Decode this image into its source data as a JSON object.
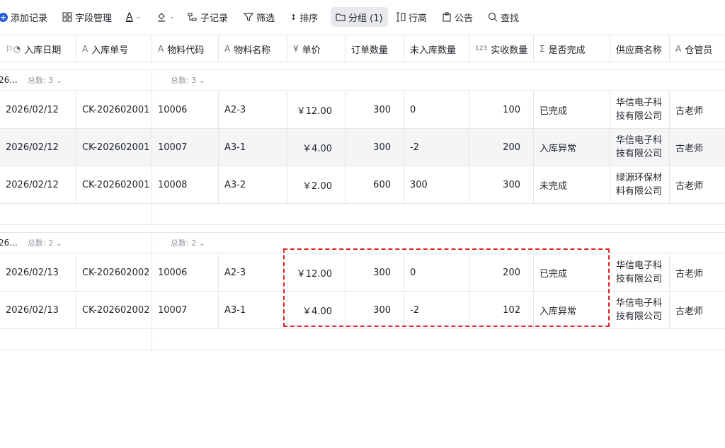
{
  "toolbar": {
    "add_record": "添加记录",
    "field_manage": "字段管理",
    "sub_record": "子记录",
    "filter": "筛选",
    "sort": "排序",
    "group": "分组 (1)",
    "row_height": "行高",
    "announcement": "公告",
    "search": "查找"
  },
  "columns": [
    {
      "label": "入库日期",
      "icon": "flag-clock-icon"
    },
    {
      "label": "入库单号",
      "icon": "text-A-icon"
    },
    {
      "label": "物料代码",
      "icon": "text-A-icon"
    },
    {
      "label": "物料名称",
      "icon": "text-A-icon"
    },
    {
      "label": "单价",
      "icon": "yen-icon"
    },
    {
      "label": "订单数量",
      "icon": ""
    },
    {
      "label": "未入库数量",
      "icon": ""
    },
    {
      "label": "实收数量",
      "icon": "number-123-icon"
    },
    {
      "label": "是否完成",
      "icon": "sigma-icon"
    },
    {
      "label": "供应商名称",
      "icon": ""
    },
    {
      "label": "仓管员",
      "icon": "text-A-icon"
    }
  ],
  "groups": [
    {
      "name": "26...",
      "count_left": "总数: 3",
      "count_right": "总数: 3",
      "rows": [
        {
          "date": "2026/02/12",
          "order_no": "CK-202602001",
          "code": "10006",
          "name": "A2-3",
          "price": "￥12.00",
          "qty": "300",
          "pending": "0",
          "received": "100",
          "status": "已完成",
          "supplier": "华信电子科技有限公司",
          "keeper": "古老师"
        },
        {
          "date": "2026/02/12",
          "order_no": "CK-202602001",
          "code": "10007",
          "name": "A3-1",
          "price": "￥4.00",
          "qty": "300",
          "pending": "-2",
          "received": "200",
          "status": "入库异常",
          "supplier": "华信电子科技有限公司",
          "keeper": "古老师"
        },
        {
          "date": "2026/02/12",
          "order_no": "CK-202602001",
          "code": "10008",
          "name": "A3-2",
          "price": "￥2.00",
          "qty": "600",
          "pending": "300",
          "received": "300",
          "status": "未完成",
          "supplier": "绿源环保材料有限公司",
          "keeper": "古老师"
        }
      ]
    },
    {
      "name": "26...",
      "count_left": "总数: 2",
      "count_right": "总数: 2",
      "rows": [
        {
          "date": "2026/02/13",
          "order_no": "CK-202602002",
          "code": "10006",
          "name": "A2-3",
          "price": "￥12.00",
          "qty": "300",
          "pending": "0",
          "received": "200",
          "status": "已完成",
          "supplier": "华信电子科技有限公司",
          "keeper": "古老师"
        },
        {
          "date": "2026/02/13",
          "order_no": "CK-202602002",
          "code": "10007",
          "name": "A3-1",
          "price": "￥4.00",
          "qty": "300",
          "pending": "-2",
          "received": "102",
          "status": "入库异常",
          "supplier": "华信电子科技有限公司",
          "keeper": "古老师"
        }
      ]
    }
  ],
  "colors": {
    "accent": "#245bdb",
    "highlight_border": "#e02424",
    "alt_row": "#f4f5f6",
    "grid_line": "#e4e6ea"
  }
}
